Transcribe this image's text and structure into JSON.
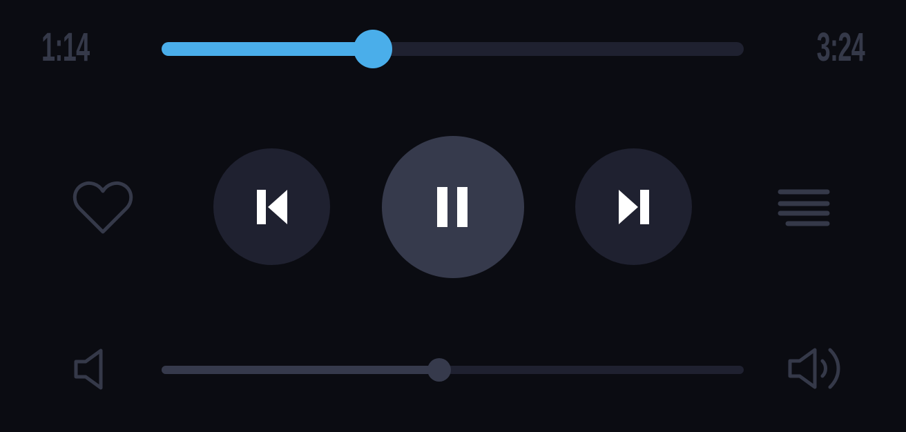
{
  "playback": {
    "elapsed": "1:14",
    "total": "3:24",
    "progress_fraction": 0.3627
  },
  "volume": {
    "level_fraction": 0.4766
  },
  "icons": {
    "favorite": "heart-outline-icon",
    "previous": "skip-previous-icon",
    "play_pause": "pause-icon",
    "next": "skip-next-icon",
    "queue": "queue-list-icon",
    "volume_low": "volume-low-icon",
    "volume_high": "volume-high-icon"
  },
  "colors": {
    "background": "#0b0c12",
    "accent": "#4aaeea",
    "button_dark": "#1f2130",
    "button_light": "#363a4c",
    "muted": "#353949",
    "icon_white": "#ffffff"
  }
}
